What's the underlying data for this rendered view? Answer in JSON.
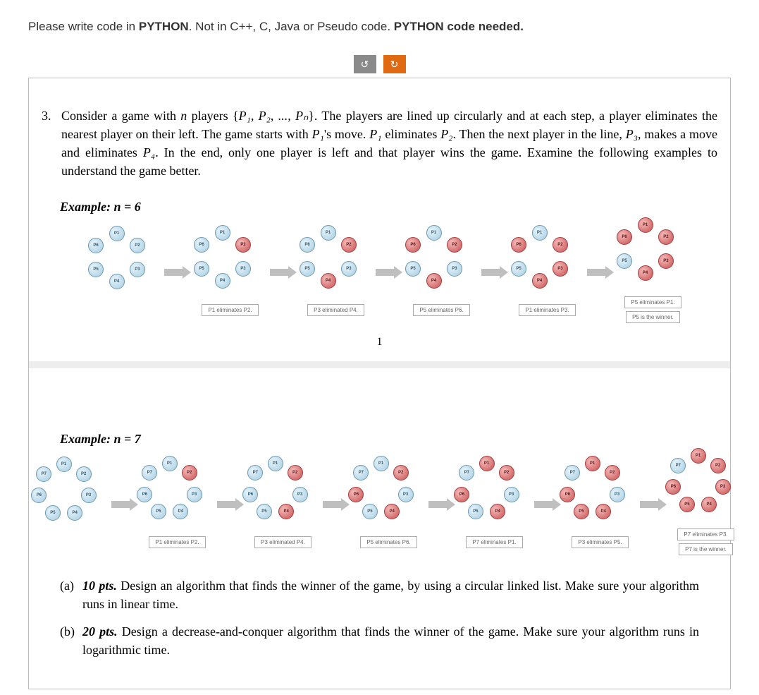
{
  "instruction": {
    "pre": "Please write code in ",
    "lang": "PYTHON",
    "mid": ". Not in C++, C, Java or Pseudo code. ",
    "tail_bold": "PYTHON code needed."
  },
  "buttons": {
    "undo_glyph": "↺",
    "redo_glyph": "↻"
  },
  "question": {
    "number": "3.",
    "text_parts": {
      "a": "Consider a game with ",
      "b": " players {",
      "c": "}. The players are lined up circularly and at each step, a player eliminates the nearest player on their left. The game starts with ",
      "d": "'s move. ",
      "e": " eliminates ",
      "f": ". Then the next player in the line, ",
      "g": ", makes a move and eliminates ",
      "h": ". In the end, only one player is left and that player wins the game. Examine the following examples to understand the game better."
    },
    "n_sym": "n",
    "set": "P₁, P₂, ..., Pₙ",
    "p1": "P₁",
    "p2": "P₂",
    "p3": "P₃",
    "p4": "P₄"
  },
  "examples": {
    "ex6": {
      "header": "Example: n = 6",
      "labels": [
        "P1",
        "P2",
        "P3",
        "P4",
        "P5",
        "P6"
      ],
      "stages": [
        {
          "dead": [],
          "caption": []
        },
        {
          "dead": [
            2
          ],
          "caption": [
            "P1 eliminates P2."
          ]
        },
        {
          "dead": [
            2,
            4
          ],
          "caption": [
            "P3 eliminated P4."
          ]
        },
        {
          "dead": [
            2,
            4,
            6
          ],
          "caption": [
            "P5 eliminates P6."
          ]
        },
        {
          "dead": [
            2,
            3,
            4,
            6
          ],
          "caption": [
            "P1 eliminates P3."
          ]
        },
        {
          "dead": [
            1,
            2,
            3,
            4,
            6
          ],
          "caption": [
            "P5 eliminates P1.",
            "P5 is the winner."
          ]
        }
      ]
    },
    "ex7": {
      "header": "Example: n = 7",
      "labels": [
        "P1",
        "P2",
        "P3",
        "P4",
        "P5",
        "P6",
        "P7"
      ],
      "stages": [
        {
          "dead": [],
          "caption": []
        },
        {
          "dead": [
            2
          ],
          "caption": [
            "P1 eliminates P2."
          ]
        },
        {
          "dead": [
            2,
            4
          ],
          "caption": [
            "P3 eliminated P4."
          ]
        },
        {
          "dead": [
            2,
            4,
            6
          ],
          "caption": [
            "P5 eliminates P6."
          ]
        },
        {
          "dead": [
            1,
            2,
            4,
            6
          ],
          "caption": [
            "P7 eliminates P1."
          ]
        },
        {
          "dead": [
            1,
            2,
            4,
            5,
            6
          ],
          "caption": [
            "P3 eliminates P5."
          ]
        },
        {
          "dead": [
            1,
            2,
            3,
            4,
            5,
            6
          ],
          "caption": [
            "P7 eliminates P3.",
            "P7 is the winner."
          ]
        }
      ]
    }
  },
  "page_number": "1",
  "parts": {
    "a": {
      "label": "(a)",
      "pts": "10 pts.",
      "text": " Design an algorithm that finds the winner of the game, by using a circular linked list. Make sure your algorithm runs in linear time."
    },
    "b": {
      "label": "(b)",
      "pts": "20 pts.",
      "text": " Design a decrease-and-conquer algorithm that finds the winner of the game. Make sure your algorithm runs in logarithmic time."
    }
  }
}
